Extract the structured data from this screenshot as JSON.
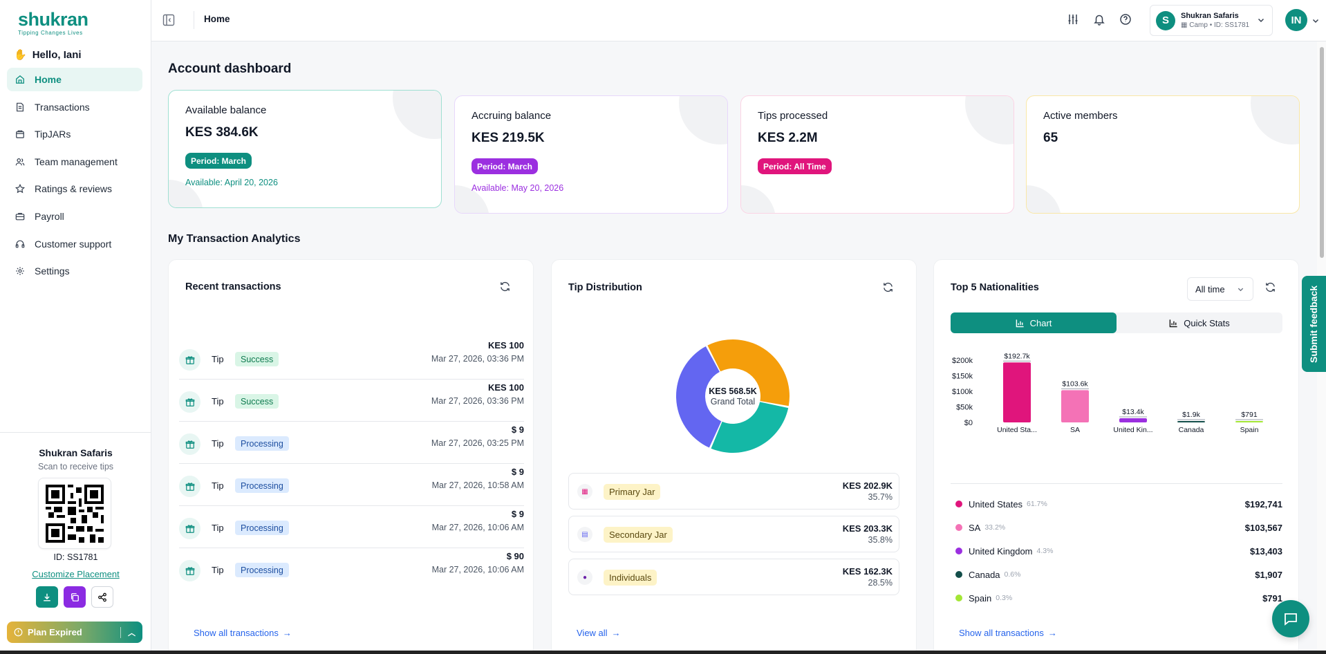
{
  "brand": {
    "name": "shukran",
    "tagline": "Tipping Changes Lives",
    "color": "#0e8f80"
  },
  "sidebar": {
    "greeting": "Hello, Iani",
    "items": [
      {
        "label": "Home",
        "icon": "home-icon",
        "active": true
      },
      {
        "label": "Transactions",
        "icon": "document-icon"
      },
      {
        "label": "TipJARs",
        "icon": "jar-icon"
      },
      {
        "label": "Team management",
        "icon": "users-icon"
      },
      {
        "label": "Ratings & reviews",
        "icon": "star-icon"
      },
      {
        "label": "Payroll",
        "icon": "briefcase-icon"
      },
      {
        "label": "Customer support",
        "icon": "headphones-icon"
      },
      {
        "label": "Settings",
        "icon": "gear-icon"
      }
    ],
    "qr": {
      "business": "Shukran Safaris",
      "scan_text": "Scan to receive tips",
      "id_text": "ID: SS1781",
      "customize": "Customize Placement"
    },
    "plan": "Plan Expired"
  },
  "topbar": {
    "breadcrumb": "Home",
    "account": {
      "initial": "S",
      "name": "Shukran Safaris",
      "sub": "Camp • ID: SS1781"
    },
    "user_initials": "IN"
  },
  "dashboard": {
    "title": "Account dashboard",
    "cards": [
      {
        "label": "Available balance",
        "value": "KES 384.6K",
        "badge": "Period: March",
        "avail": "Available: April 20, 2026",
        "accent": "#0e8f80",
        "border": "#9fe0d2"
      },
      {
        "label": "Accruing balance",
        "value": "KES 219.5K",
        "badge": "Period: March",
        "avail": "Available: May 20, 2026",
        "accent": "#9b2fe0",
        "border": "#e7d7fb"
      },
      {
        "label": "Tips processed",
        "value": "KES 2.2M",
        "badge": "Period: All Time",
        "avail": "",
        "accent": "#e0157c",
        "border": "#fbd3e4"
      },
      {
        "label": "Active members",
        "value": "65",
        "badge": "",
        "avail": "",
        "accent": "#f5c518",
        "border": "#f9e7a6"
      }
    ]
  },
  "analytics": {
    "title": "My Transaction Analytics",
    "recent": {
      "title": "Recent transactions",
      "rows": [
        {
          "type": "Tip",
          "status": "Success",
          "amount": "KES 100",
          "date": "Mar 27, 2026, 03:36 PM"
        },
        {
          "type": "Tip",
          "status": "Success",
          "amount": "KES 100",
          "date": "Mar 27, 2026, 03:36 PM"
        },
        {
          "type": "Tip",
          "status": "Processing",
          "amount": "$ 9",
          "date": "Mar 27, 2026, 03:25 PM"
        },
        {
          "type": "Tip",
          "status": "Processing",
          "amount": "$ 9",
          "date": "Mar 27, 2026, 10:58 AM"
        },
        {
          "type": "Tip",
          "status": "Processing",
          "amount": "$ 9",
          "date": "Mar 27, 2026, 10:06 AM"
        },
        {
          "type": "Tip",
          "status": "Processing",
          "amount": "$ 90",
          "date": "Mar 27, 2026, 10:06 AM"
        }
      ],
      "show_all": "Show all transactions"
    },
    "tips": {
      "title": "Tip Distribution",
      "total": "KES 568.5K",
      "total_label": "Grand Total",
      "jars": [
        {
          "name": "Primary Jar",
          "amount": "KES 202.9K",
          "pct": "35.7%",
          "share": 0.357,
          "color": "#f59e0b"
        },
        {
          "name": "Secondary Jar",
          "amount": "KES 203.3K",
          "pct": "35.8%",
          "share": 0.358,
          "color": "#6366f1"
        },
        {
          "name": "Individuals",
          "amount": "KES 162.3K",
          "pct": "28.5%",
          "share": 0.285,
          "color": "#14b8a6"
        }
      ],
      "view_all": "View all"
    },
    "nationalities": {
      "title": "Top 5 Nationalities",
      "period": "All time",
      "tab_chart": "Chart",
      "tab_stats": "Quick Stats",
      "list": [
        {
          "name": "United States",
          "pct": "61.7%",
          "value": "$192,741",
          "color": "#e0157c"
        },
        {
          "name": "SA",
          "pct": "33.2%",
          "value": "$103,567",
          "color": "#f472b6"
        },
        {
          "name": "United Kingdom",
          "pct": "4.3%",
          "value": "$13,403",
          "color": "#9b2fe0"
        },
        {
          "name": "Canada",
          "pct": "0.6%",
          "value": "$1,907",
          "color": "#134e4a"
        },
        {
          "name": "Spain",
          "pct": "0.3%",
          "value": "$791",
          "color": "#a3e635"
        }
      ],
      "show_all": "Show all transactions"
    }
  },
  "chart_data": {
    "type": "bar",
    "categories": [
      "United Sta...",
      "SA",
      "United Kin...",
      "Canada",
      "Spain"
    ],
    "values": [
      192741,
      103567,
      13403,
      1907,
      791
    ],
    "data_labels": [
      "$192.7k",
      "$103.6k",
      "$13.4k",
      "$1.9k",
      "$791"
    ],
    "colors": [
      "#e0157c",
      "#f472b6",
      "#9b2fe0",
      "#134e4a",
      "#a3e635"
    ],
    "yticks": [
      "$0",
      "$50k",
      "$100k",
      "$150k",
      "$200k"
    ],
    "ylim": [
      0,
      200000
    ]
  },
  "feedback": "Submit feedback"
}
